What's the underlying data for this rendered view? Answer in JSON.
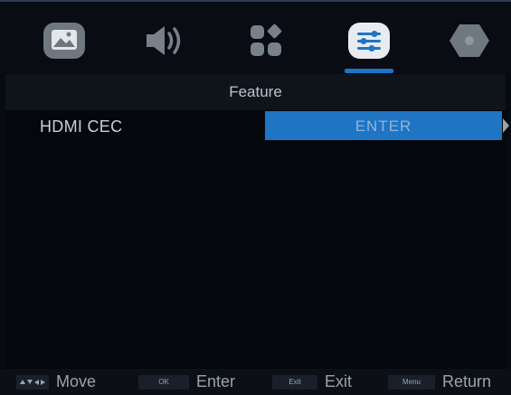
{
  "tabs": [
    {
      "icon": "picture-icon",
      "active": false
    },
    {
      "icon": "sound-icon",
      "active": false
    },
    {
      "icon": "channel-icon",
      "active": false
    },
    {
      "icon": "feature-icon",
      "active": true
    },
    {
      "icon": "setup-icon",
      "active": false
    }
  ],
  "colors": {
    "accent": "#1f74c4",
    "background": "#070a10",
    "text": "#c8d0d8"
  },
  "header": {
    "title": "Feature"
  },
  "menu": {
    "items": [
      {
        "label": "HDMI CEC",
        "value": "ENTER"
      }
    ]
  },
  "footer": {
    "hints": [
      {
        "key": "",
        "label": "Move"
      },
      {
        "key": "OK",
        "label": "Enter"
      },
      {
        "key": "Exit",
        "label": "Exit"
      },
      {
        "key": "Menu",
        "label": "Return"
      }
    ]
  }
}
